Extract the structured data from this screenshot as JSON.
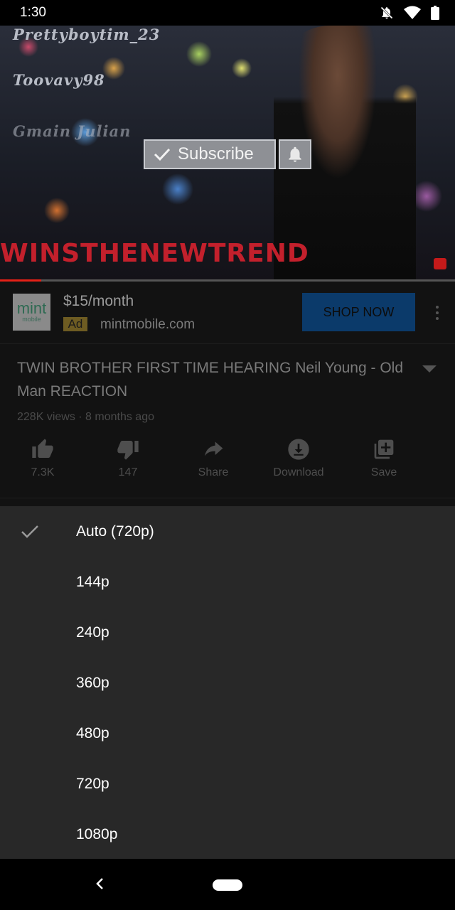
{
  "status_bar": {
    "time": "1:30",
    "icons": [
      "notifications-off-icon",
      "wifi-icon",
      "battery-icon"
    ]
  },
  "video": {
    "overlay_names": [
      "Prettyboytim_23",
      "Toovavy98",
      "Gmain Julian"
    ],
    "subscribe_label": "Subscribe",
    "banner_text": "WINSTHENEWTREND",
    "progress_fraction": 0.09,
    "progress_color": "#e62117"
  },
  "ad": {
    "logo_text": "mint",
    "logo_subtext": "mobile",
    "price": "$15/month",
    "badge": "Ad",
    "domain": "mintmobile.com",
    "cta": "SHOP NOW",
    "cta_color": "#0b3a6a"
  },
  "video_info": {
    "title": "TWIN BROTHER FIRST TIME HEARING Neil Young - Old Man REACTION",
    "meta": "228K views · 8 months ago"
  },
  "actions": [
    {
      "icon": "thumbs-up-icon",
      "label": "7.3K"
    },
    {
      "icon": "thumbs-down-icon",
      "label": "147"
    },
    {
      "icon": "share-icon",
      "label": "Share"
    },
    {
      "icon": "download-icon",
      "label": "Download"
    },
    {
      "icon": "add-to-playlist-icon",
      "label": "Save"
    }
  ],
  "quality_menu": {
    "selected": "Auto (720p)",
    "options": [
      "Auto (720p)",
      "144p",
      "240p",
      "360p",
      "480p",
      "720p",
      "1080p"
    ]
  },
  "nav_bar": {
    "icons": [
      "back-icon",
      "home-pill-icon"
    ]
  }
}
